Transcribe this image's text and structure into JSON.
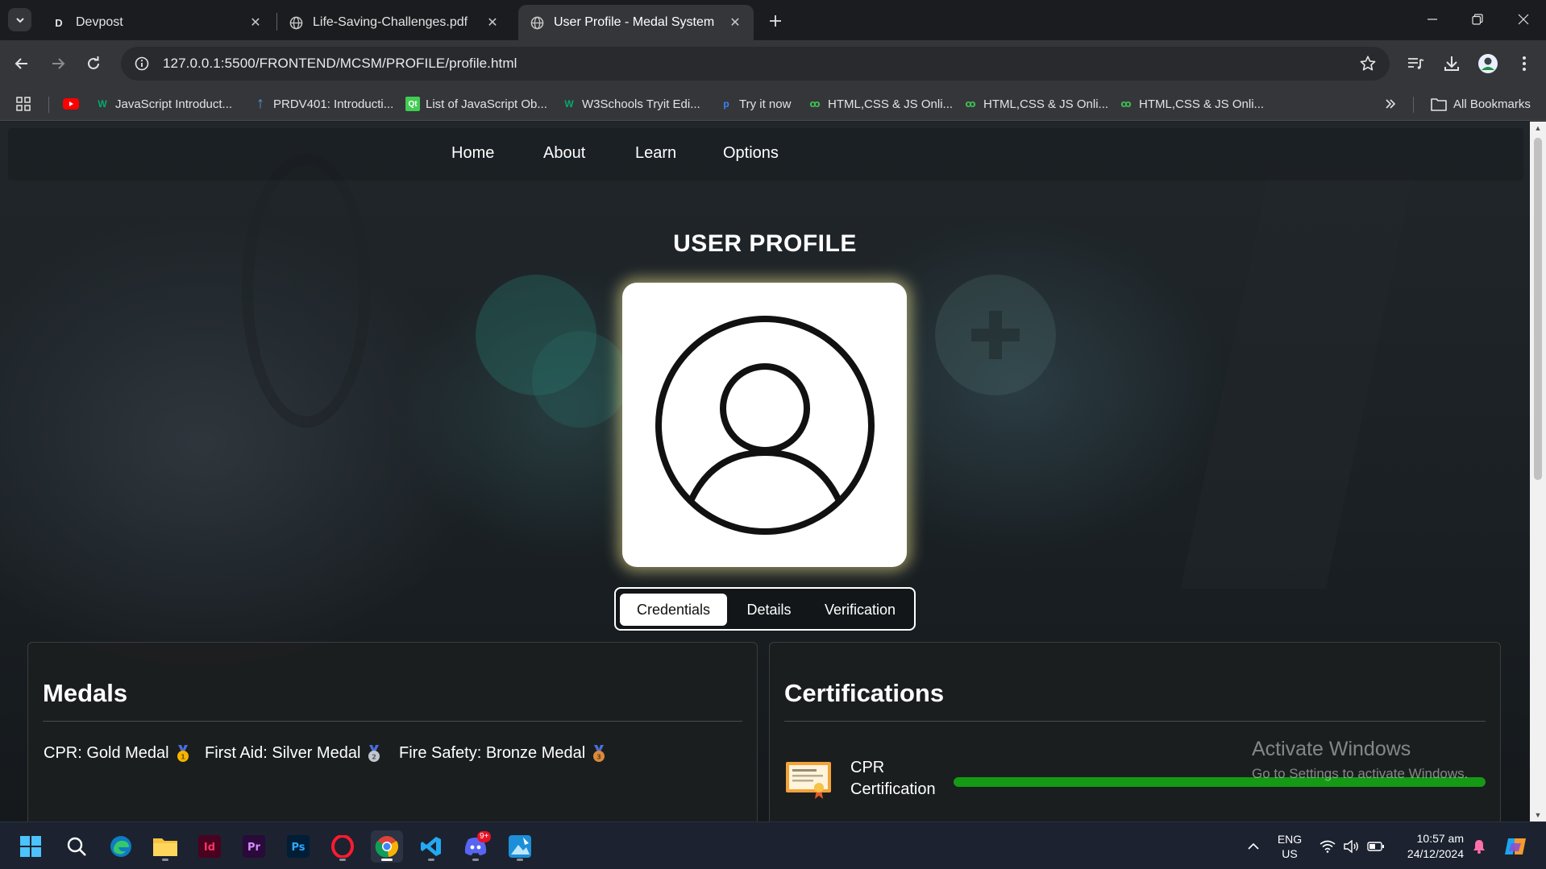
{
  "browser": {
    "tabs": [
      {
        "title": "Devpost",
        "favicon_letter": "D",
        "active": false
      },
      {
        "title": "Life-Saving-Challenges.pdf",
        "favicon_letter": "",
        "active": false
      },
      {
        "title": "User Profile - Medal System",
        "favicon_letter": "",
        "active": true
      }
    ],
    "url": "127.0.0.1:5500/FRONTEND/MCSM/PROFILE/profile.html",
    "bookmarks": [
      {
        "label": "",
        "icon": "youtube-icon"
      },
      {
        "label": "JavaScript Introduct...",
        "icon": "w3schools-icon"
      },
      {
        "label": "PRDV401: Introducti...",
        "icon": "saylor-icon"
      },
      {
        "label": "List of JavaScript Ob...",
        "icon": "qt-icon"
      },
      {
        "label": "W3Schools Tryit Edi...",
        "icon": "w3schools-icon"
      },
      {
        "label": "Try it now",
        "icon": "p-icon"
      },
      {
        "label": "HTML,CSS & JS Onli...",
        "icon": "codepen-icon"
      },
      {
        "label": "HTML,CSS & JS Onli...",
        "icon": "codepen-icon"
      },
      {
        "label": "HTML,CSS & JS Onli...",
        "icon": "codepen-icon"
      }
    ],
    "all_bookmarks_label": "All Bookmarks"
  },
  "page": {
    "nav": [
      "Home",
      "About",
      "Learn",
      "Options"
    ],
    "title": "USER PROFILE",
    "profile_tabs": [
      {
        "label": "Credentials",
        "active": true
      },
      {
        "label": "Details",
        "active": false
      },
      {
        "label": "Verification",
        "active": false
      }
    ],
    "medals": {
      "heading": "Medals",
      "items": [
        {
          "text": "CPR: Gold Medal",
          "tier": "gold"
        },
        {
          "text": "First Aid: Silver Medal",
          "tier": "silver"
        },
        {
          "text": "Fire Safety: Bronze Medal",
          "tier": "bronze"
        }
      ]
    },
    "certifications": {
      "heading": "Certifications",
      "items": [
        {
          "label": "CPR Certification",
          "progress": 1.0
        }
      ]
    }
  },
  "watermark": {
    "line1": "Activate Windows",
    "line2": "Go to Settings to activate Windows."
  },
  "taskbar": {
    "lang_line1": "ENG",
    "lang_line2": "US",
    "time": "10:57 am",
    "date": "24/12/2024",
    "discord_badge": "9+"
  },
  "colors": {
    "progress_fill": "#149a14",
    "avatar_glow": "#fff096",
    "accent_green": "#1e8e3e"
  }
}
